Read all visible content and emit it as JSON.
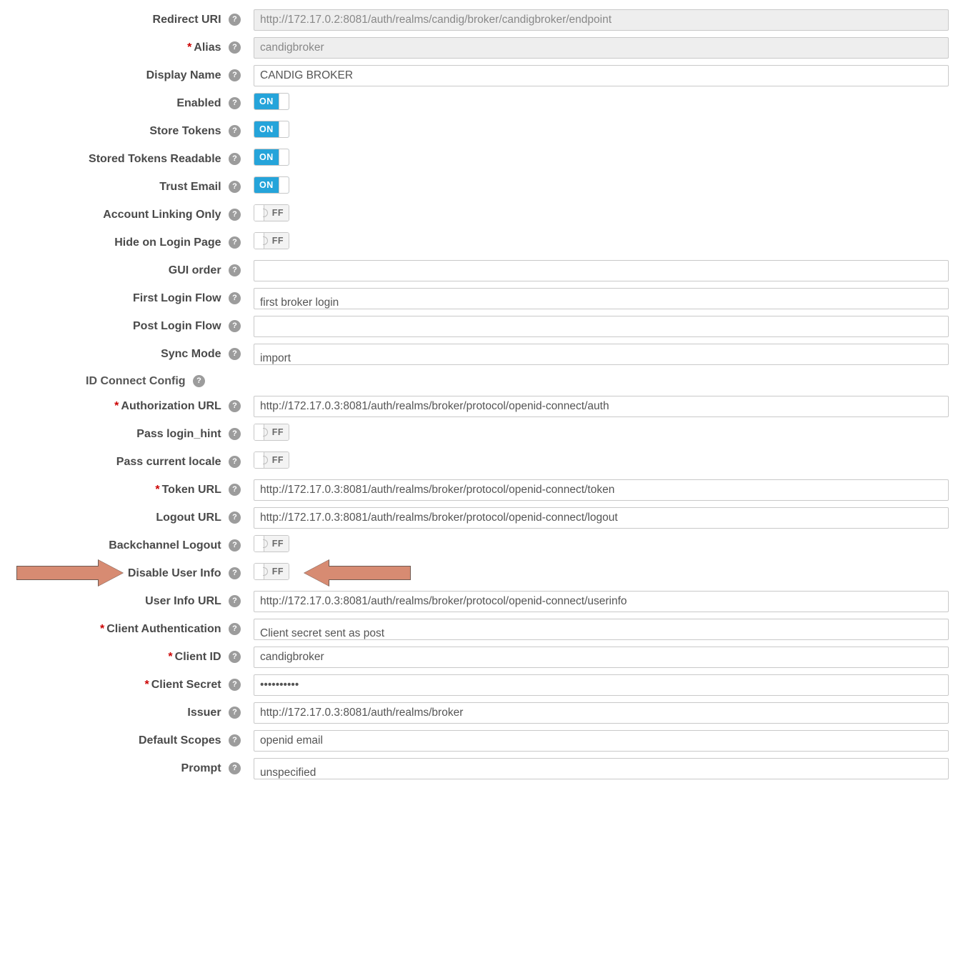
{
  "labels": {
    "redirect_uri": "Redirect URI",
    "alias": "Alias",
    "display_name": "Display Name",
    "enabled": "Enabled",
    "store_tokens": "Store Tokens",
    "stored_tokens_readable": "Stored Tokens Readable",
    "trust_email": "Trust Email",
    "account_linking_only": "Account Linking Only",
    "hide_on_login_page": "Hide on Login Page",
    "gui_order": "GUI order",
    "first_login_flow": "First Login Flow",
    "post_login_flow": "Post Login Flow",
    "sync_mode": "Sync Mode",
    "section_oidc": "ID Connect Config",
    "authorization_url": "Authorization URL",
    "pass_login_hint": "Pass login_hint",
    "pass_current_locale": "Pass current locale",
    "token_url": "Token URL",
    "logout_url": "Logout URL",
    "backchannel_logout": "Backchannel Logout",
    "disable_user_info": "Disable User Info",
    "user_info_url": "User Info URL",
    "client_authentication": "Client Authentication",
    "client_id": "Client ID",
    "client_secret": "Client Secret",
    "issuer": "Issuer",
    "default_scopes": "Default Scopes",
    "prompt": "Prompt"
  },
  "values": {
    "redirect_uri": "http://172.17.0.2:8081/auth/realms/candig/broker/candigbroker/endpoint",
    "alias": "candigbroker",
    "display_name": "CANDIG BROKER",
    "enabled": "ON",
    "store_tokens": "ON",
    "stored_tokens_readable": "ON",
    "trust_email": "ON",
    "account_linking_only": "FF",
    "hide_on_login_page": "FF",
    "gui_order": "",
    "first_login_flow": "first broker login",
    "post_login_flow": "",
    "sync_mode": "import",
    "authorization_url": "http://172.17.0.3:8081/auth/realms/broker/protocol/openid-connect/auth",
    "pass_login_hint": "FF",
    "pass_current_locale": "FF",
    "token_url": "http://172.17.0.3:8081/auth/realms/broker/protocol/openid-connect/token",
    "logout_url": "http://172.17.0.3:8081/auth/realms/broker/protocol/openid-connect/logout",
    "backchannel_logout": "FF",
    "disable_user_info": "FF",
    "user_info_url": "http://172.17.0.3:8081/auth/realms/broker/protocol/openid-connect/userinfo",
    "client_authentication": "Client secret sent as post",
    "client_id": "candigbroker",
    "client_secret": "••••••••••",
    "issuer": "http://172.17.0.3:8081/auth/realms/broker",
    "default_scopes": "openid email",
    "prompt": "unspecified"
  },
  "toggle_text": {
    "on": "ON",
    "off": "FF"
  }
}
